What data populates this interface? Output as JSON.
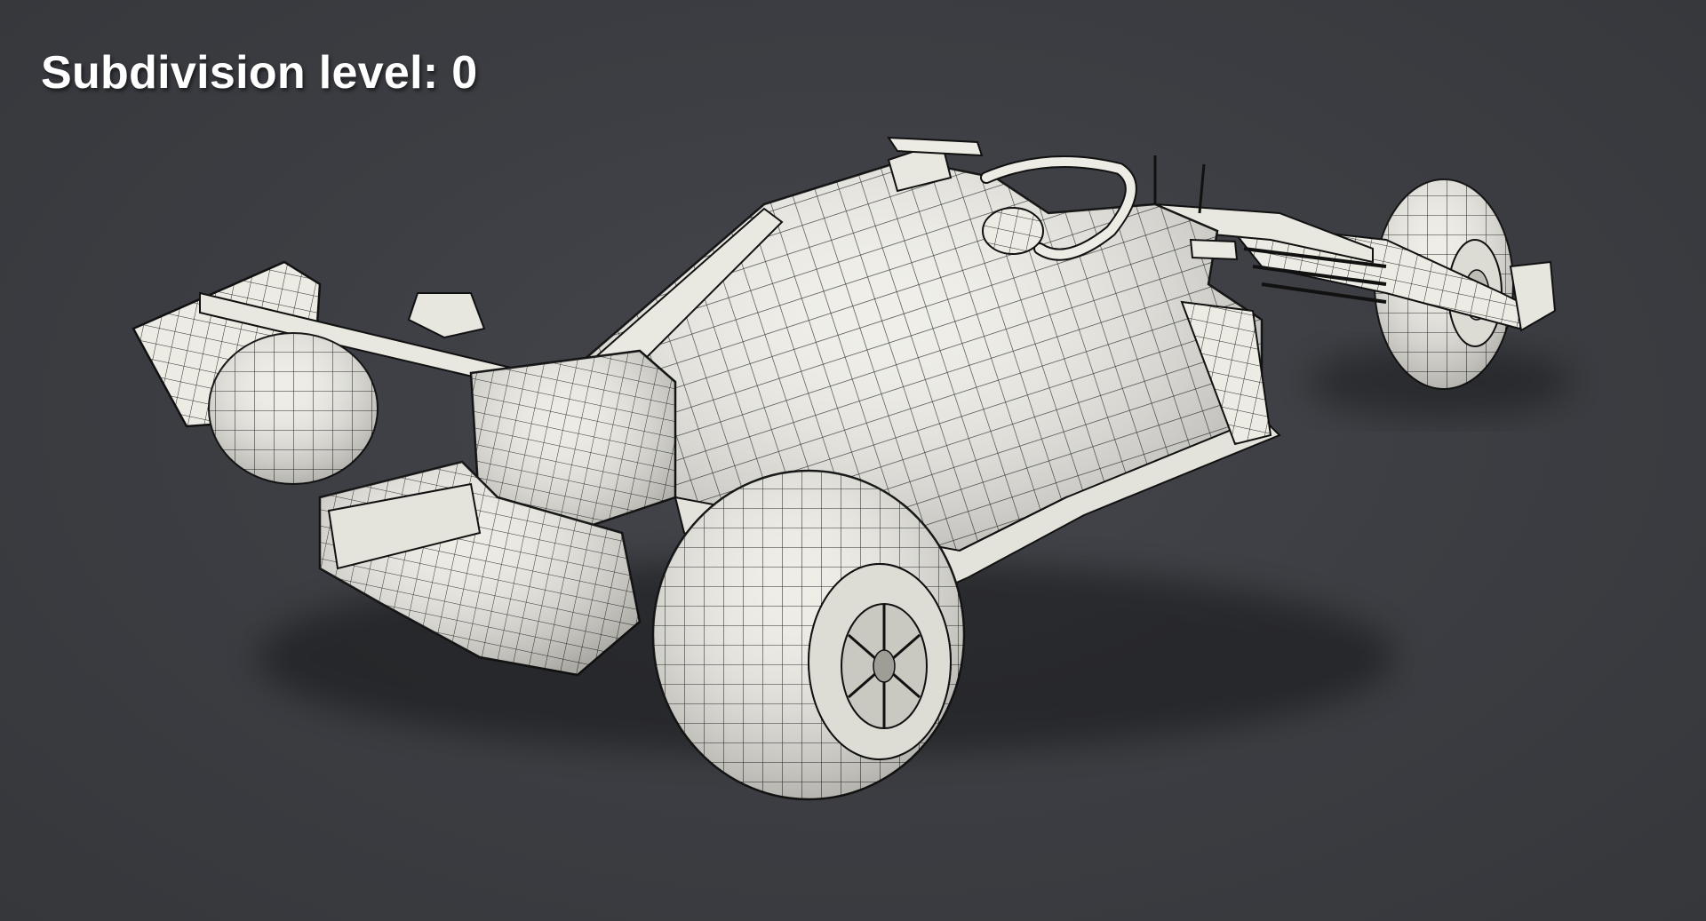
{
  "overlay": {
    "subdivision_label": "Subdivision level: 0"
  },
  "scene": {
    "subject": "race-car-wireframe-model",
    "background_color": "#3a3c41",
    "mesh_fill_color": "#efeee8",
    "wire_color": "#1a1a1a"
  }
}
